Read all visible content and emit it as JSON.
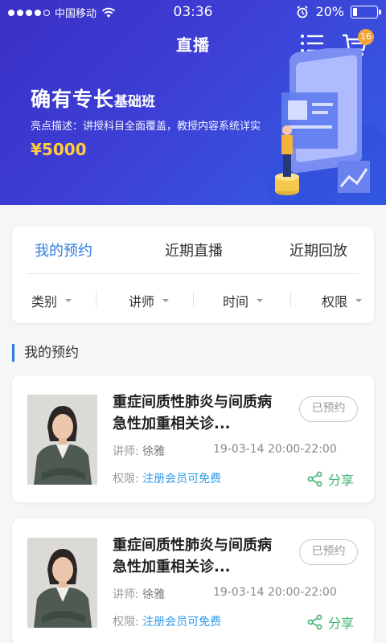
{
  "status_bar": {
    "carrier": "中国移动",
    "time": "03:36",
    "battery_percent": 20,
    "battery_text": "20%"
  },
  "nav": {
    "title": "直播",
    "cart_badge": "16"
  },
  "banner": {
    "title_main": "确有专长",
    "title_sub": "基础班",
    "description": "亮点描述：讲授科目全面覆盖，教授内容系统详实",
    "price": "¥5000"
  },
  "tabs": [
    {
      "label": "我的预约",
      "active": true
    },
    {
      "label": "近期直播",
      "active": false
    },
    {
      "label": "近期回放",
      "active": false
    }
  ],
  "filters": [
    "类别",
    "讲师",
    "时间",
    "权限"
  ],
  "section": {
    "title": "我的预约"
  },
  "courses": [
    {
      "title": "重症间质性肺炎与间质病急性加重相关诊...",
      "status": "已预约",
      "teacher_label": "讲师:",
      "teacher": "徐雅",
      "time": "19-03-14  20:00-22:00",
      "permission_label": "权限:",
      "permission": "注册会员可免费",
      "share": "分享"
    },
    {
      "title": "重症间质性肺炎与间质病急性加重相关诊...",
      "status": "已预约",
      "teacher_label": "讲师:",
      "teacher": "徐雅",
      "time": "19-03-14  20:00-22:00",
      "permission_label": "权限:",
      "permission": "注册会员可免费",
      "share": "分享"
    }
  ],
  "colors": {
    "accent": "#2f7de0",
    "price": "#ffcd3c",
    "share_green": "#3cb371",
    "badge": "#f2a33a"
  }
}
